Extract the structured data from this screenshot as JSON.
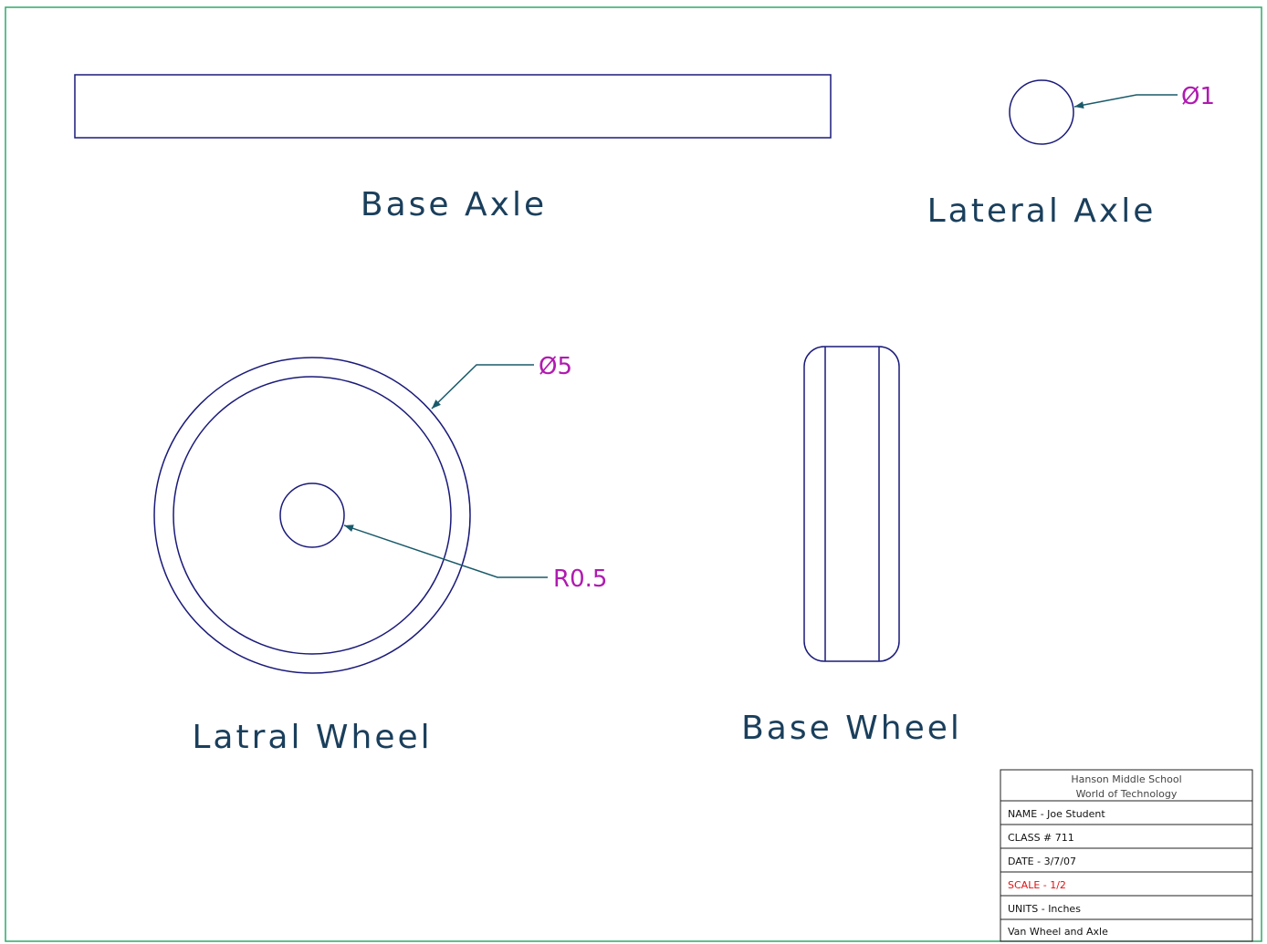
{
  "labels": {
    "base_axle": "Base Axle",
    "lateral_axle": "Lateral Axle",
    "latral_wheel": "Latral Wheel",
    "base_wheel": "Base Wheel"
  },
  "dimensions": {
    "lateral_axle_dia": "Ø1",
    "wheel_dia": "Ø5",
    "hub_radius": "R0.5"
  },
  "title_block": {
    "school": "Hanson Middle School",
    "program": "World of Technology",
    "name": "NAME - Joe Student",
    "class": "CLASS # 711",
    "date": "DATE - 3/7/07",
    "scale": "SCALE - 1/2",
    "units": "UNITS - Inches",
    "drawing": "Van Wheel and Axle"
  },
  "colors": {
    "border": "#2eaa6a",
    "geometry": "#1a1a7a",
    "leader": "#1a5a6a",
    "dimension_text": "#b01ab0",
    "label_text": "#1a3f5c",
    "scale_text": "#e01010"
  }
}
